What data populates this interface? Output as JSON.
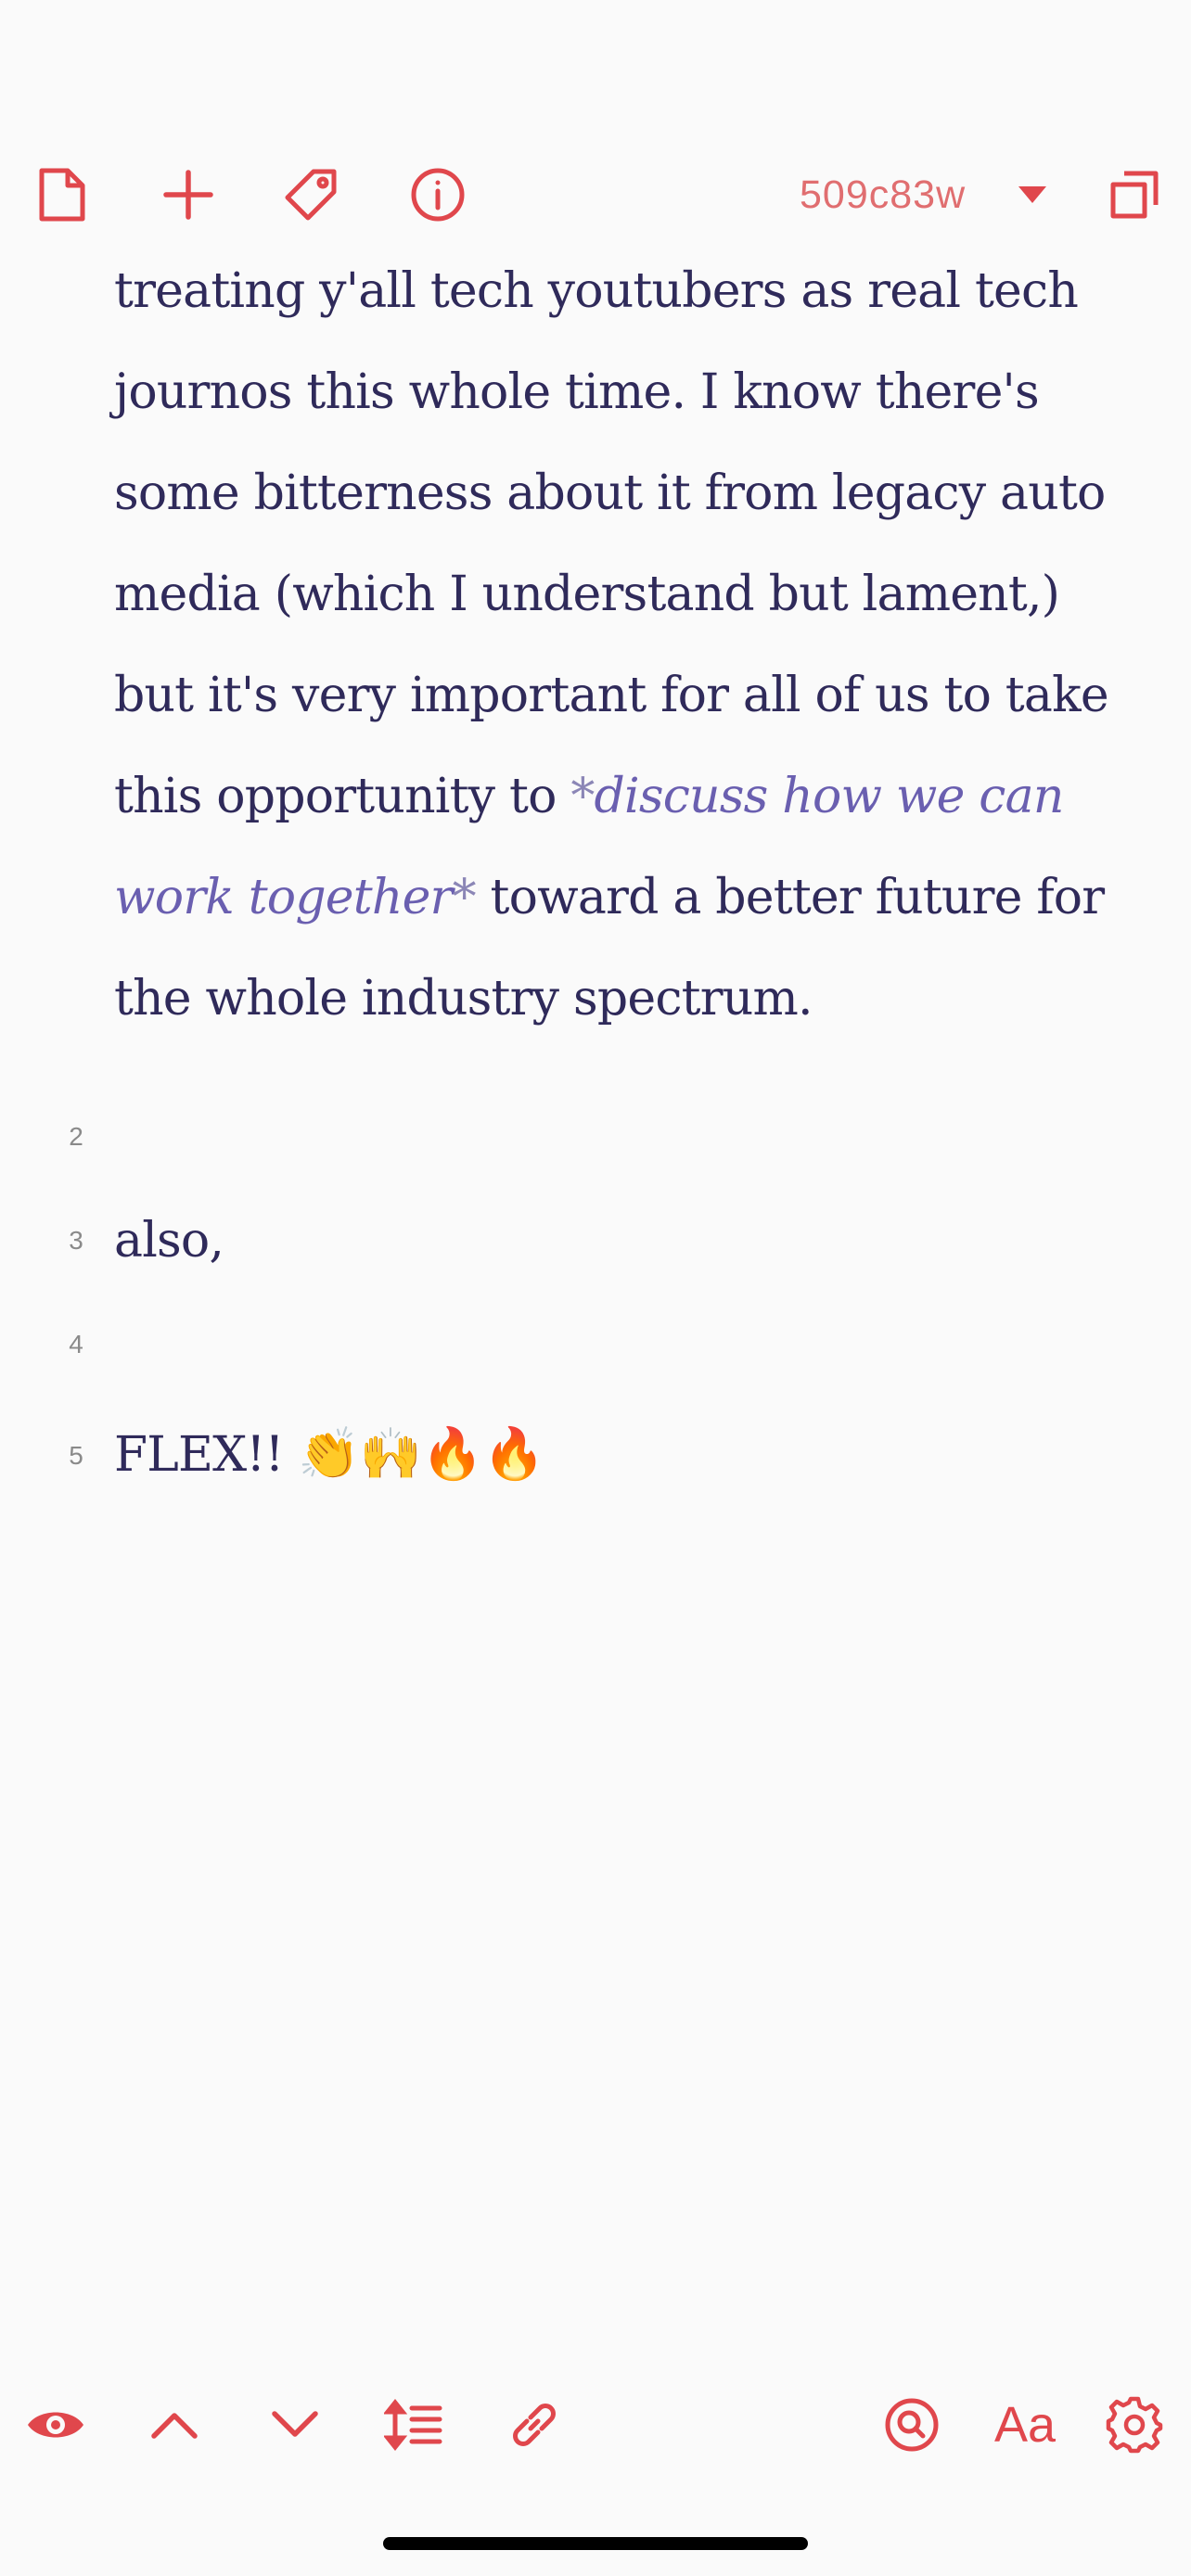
{
  "toolbar_top": {
    "commit_label": "509c83w",
    "icons": [
      "document-icon",
      "plus-icon",
      "tag-icon",
      "info-icon",
      "dropdown-caret-icon",
      "expand-window-icon"
    ]
  },
  "editor": {
    "paragraph": {
      "part1": "treating y'all tech youtubers as real tech journos this whole time. I know there's some bitterness about it from legacy auto media (which I understand but lament,) but it's very important for all of us to take this opportunity to ",
      "emph_open": "*",
      "emph_text": "discuss how we can work together",
      "emph_close": "*",
      "part2": " toward a better future for the whole industry spectrum."
    },
    "lines": [
      {
        "number": "2",
        "text": ""
      },
      {
        "number": "3",
        "text": "also,"
      },
      {
        "number": "4",
        "text": ""
      },
      {
        "number": "5",
        "text": "FLEX!! ",
        "emojis": "👏🙌🔥🔥"
      }
    ]
  },
  "toolbar_bottom": {
    "font_button_label": "Aa",
    "icons": [
      "eye-icon",
      "chevron-up-icon",
      "chevron-down-icon",
      "line-spacing-icon",
      "link-icon",
      "search-icon",
      "gear-icon"
    ]
  },
  "colors": {
    "accent": "#e0474c",
    "text": "#2f2a5a",
    "emphasis": "#6a5fb0",
    "background": "#fafafa"
  }
}
